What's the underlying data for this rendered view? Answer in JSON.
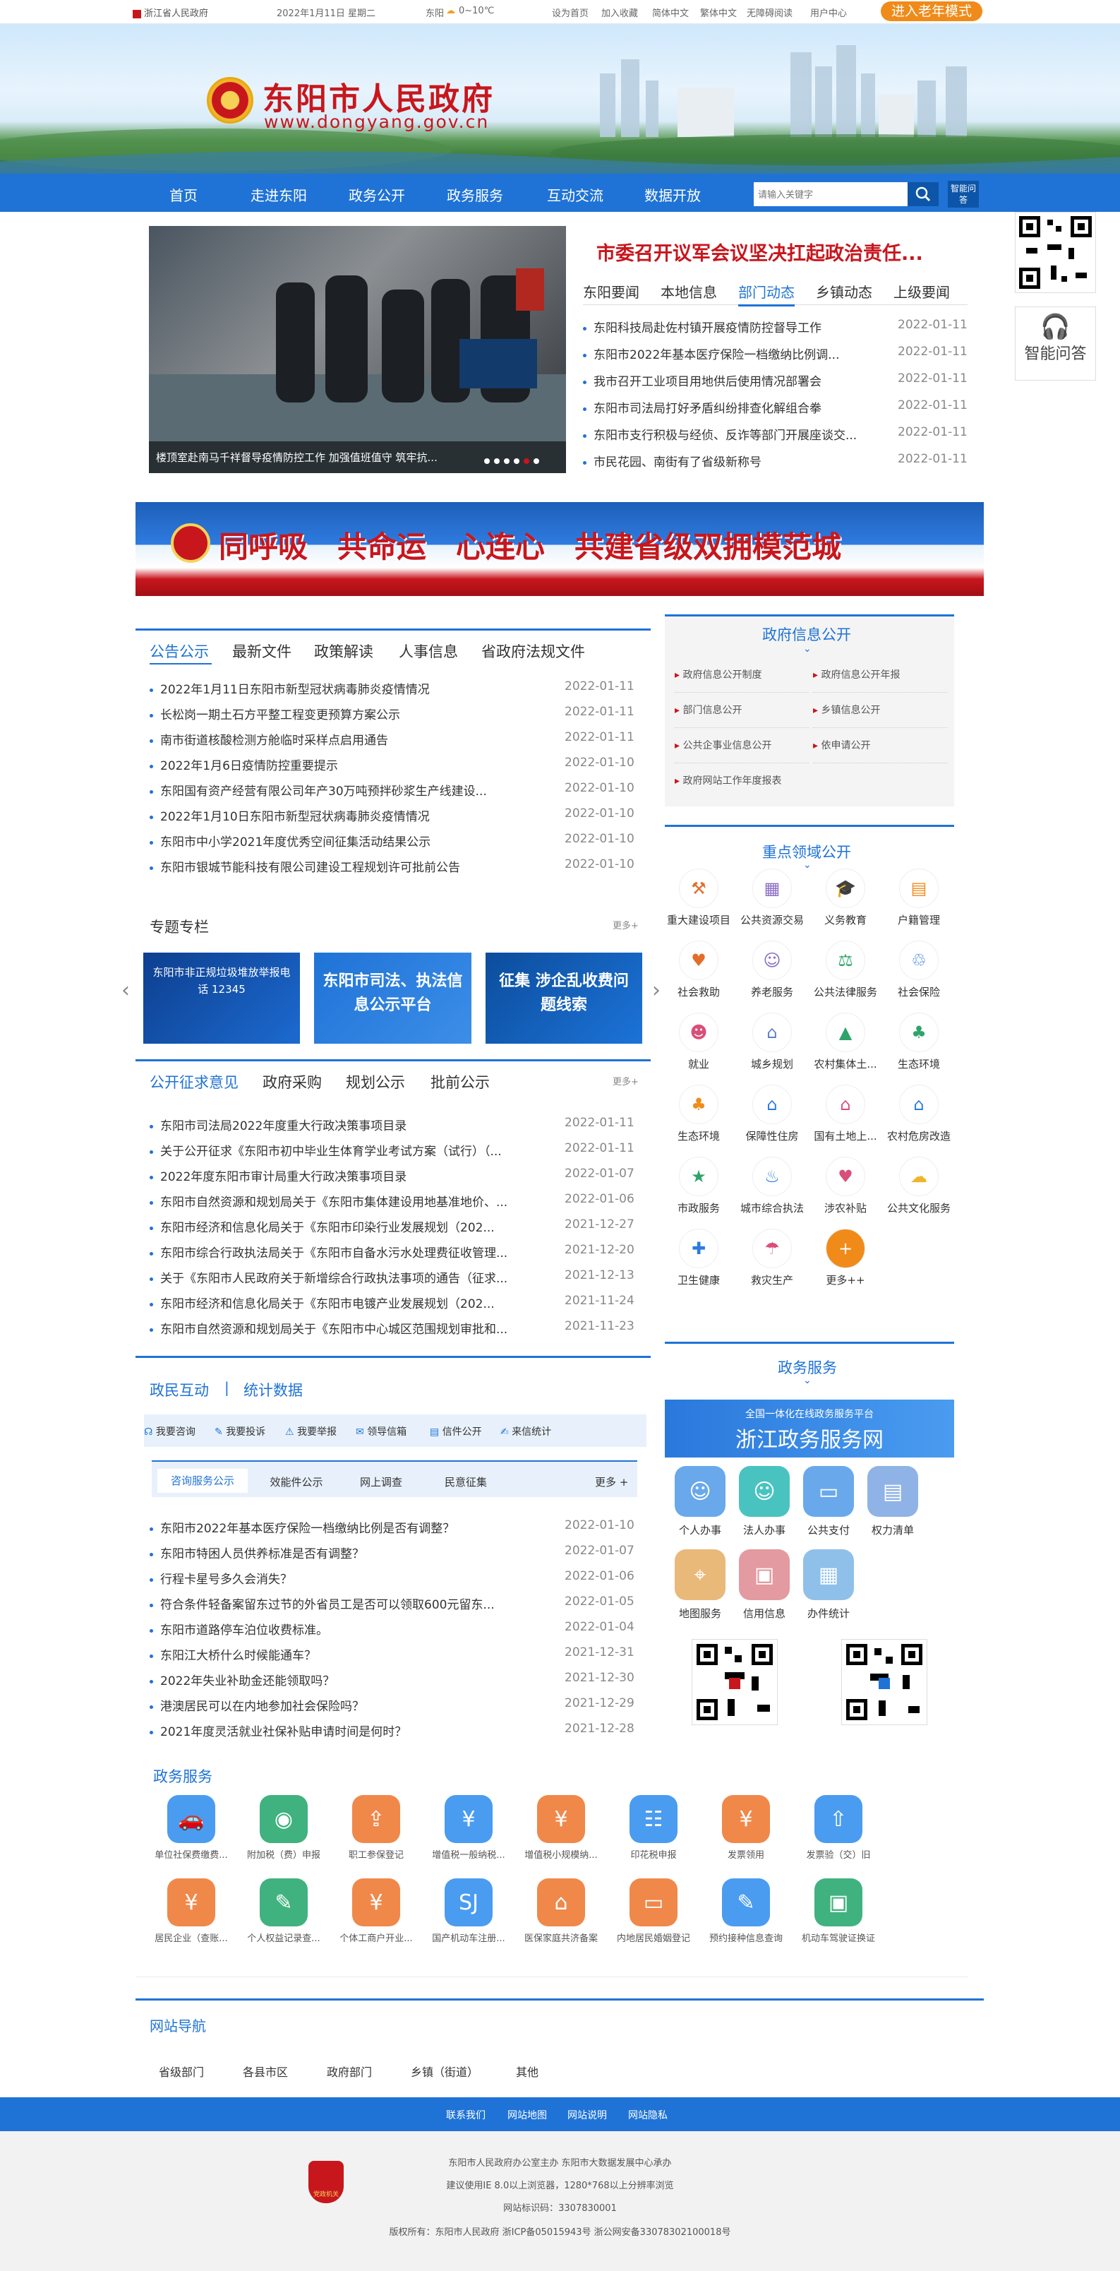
{
  "topbar": {
    "site": "浙江省人民政府",
    "date": "2022年1月11日 星期二",
    "weather_city": "东阳",
    "weather_temp": "0~10℃",
    "links": [
      "设为首页",
      "加入收藏",
      "简体中文",
      "繁体中文",
      "无障碍阅读"
    ],
    "user": "用户中心",
    "elder": "进入老年模式"
  },
  "banner": {
    "title": "东阳市人民政府",
    "url": "www.dongyang.gov.cn"
  },
  "nav": {
    "items": [
      "首页",
      "走进东阳",
      "政务公开",
      "政务服务",
      "互动交流",
      "数据开放"
    ],
    "search_placeholder": "请输入关键字",
    "qa_button": "智能问答"
  },
  "side": {
    "qa_label": "智能问答"
  },
  "headline": {
    "title": "市委召开议军会议坚决扛起政治责任...",
    "caption": "楼顶室赴南马千祥督导疫情防控工作 加强值班值守 筑牢抗..."
  },
  "news_tabs": [
    "东阳要闻",
    "本地信息",
    "部门动态",
    "乡镇动态",
    "上级要闻"
  ],
  "news_list": [
    {
      "t": "东阳科技局赴佐村镇开展疫情防控督导工作",
      "d": "2022-01-11"
    },
    {
      "t": "东阳市2022年基本医疗保险一档缴纳比例调...",
      "d": "2022-01-11"
    },
    {
      "t": "我市召开工业项目用地供后使用情况部署会",
      "d": "2022-01-11"
    },
    {
      "t": "东阳市司法局打好矛盾纠纷排查化解组合拳",
      "d": "2022-01-11"
    },
    {
      "t": "东阳市支行积极与经侦、反诈等部门开展座谈交...",
      "d": "2022-01-11"
    },
    {
      "t": "市民花园、南街有了省级新称号",
      "d": "2022-01-11"
    }
  ],
  "slogan": "同呼吸　共命运　心连心　共建省级双拥模范城",
  "notice_tabs": [
    "公告公示",
    "最新文件",
    "政策解读",
    "人事信息",
    "省政府法规文件"
  ],
  "notice_list": [
    {
      "t": "2022年1月11日东阳市新型冠状病毒肺炎疫情情况",
      "d": "2022-01-11"
    },
    {
      "t": "长松岗一期土石方平整工程变更预算方案公示",
      "d": "2022-01-11"
    },
    {
      "t": "南市街道核酸检测方舱临时采样点启用通告",
      "d": "2022-01-11"
    },
    {
      "t": "2022年1月6日疫情防控重要提示",
      "d": "2022-01-10"
    },
    {
      "t": "东阳国有资产经营有限公司年产30万吨预拌砂浆生产线建设...",
      "d": "2022-01-10"
    },
    {
      "t": "2022年1月10日东阳市新型冠状病毒肺炎疫情情况",
      "d": "2022-01-10"
    },
    {
      "t": "东阳市中小学2021年度优秀空间征集活动结果公示",
      "d": "2022-01-10"
    },
    {
      "t": "东阳市银城节能科技有限公司建设工程规划许可批前公告",
      "d": "2022-01-10"
    }
  ],
  "special": {
    "title": "专题专栏",
    "more": "更多+",
    "cards": [
      "东阳市非正规垃圾堆放举报电话 12345",
      "东阳市司法、执法信息公示平台",
      "征集 涉企乱收费问题线索"
    ]
  },
  "consult_tabs": [
    "公开征求意见",
    "政府采购",
    "规划公示",
    "批前公示"
  ],
  "consult_more": "更多+",
  "consult_list": [
    {
      "t": "东阳市司法局2022年度重大行政决策事项目录",
      "d": "2022-01-11"
    },
    {
      "t": "关于公开征求《东阳市初中毕业生体育学业考试方案（试行）（...",
      "d": "2022-01-11"
    },
    {
      "t": "2022年度东阳市审计局重大行政决策事项目录",
      "d": "2022-01-07"
    },
    {
      "t": "东阳市自然资源和规划局关于《东阳市集体建设用地基准地价、...",
      "d": "2022-01-06"
    },
    {
      "t": "东阳市经济和信息化局关于《东阳市印染行业发展规划（202...",
      "d": "2021-12-27"
    },
    {
      "t": "东阳市综合行政执法局关于《东阳市自备水污水处理费征收管理...",
      "d": "2021-12-20"
    },
    {
      "t": "关于《东阳市人民政府关于新增综合行政执法事项的通告（征求...",
      "d": "2021-12-13"
    },
    {
      "t": "东阳市经济和信息化局关于《东阳市电镀产业发展规划（202...",
      "d": "2021-11-24"
    },
    {
      "t": "东阳市自然资源和规划局关于《东阳市中心城区范围规划审批和...",
      "d": "2021-11-23"
    }
  ],
  "gov_info": {
    "title": "政府信息公开",
    "items": [
      "政府信息公开制度",
      "政府信息公开年报",
      "部门信息公开",
      "乡镇信息公开",
      "公共企事业信息公开",
      "依申请公开",
      "政府网站工作年度报表"
    ]
  },
  "key_area": {
    "title": "重点领域公开",
    "items": [
      "重大建设项目",
      "公共资源交易",
      "义务教育",
      "户籍管理",
      "社会救助",
      "养老服务",
      "公共法律服务",
      "社会保险",
      "就业",
      "城乡规划",
      "农村集体土...",
      "生态环境",
      "生态环境",
      "保障性住房",
      "国有土地上...",
      "农村危房改造",
      "市政服务",
      "城市综合执法",
      "涉农补贴",
      "公共文化服务",
      "卫生健康",
      "救灾生产",
      "更多++"
    ]
  },
  "interact": {
    "tab1": "政民互动",
    "tab2": "统计数据",
    "tools": [
      "我要咨询",
      "我要投诉",
      "我要举报",
      "领导信箱",
      "信件公开",
      "来信统计"
    ],
    "subtabs": [
      "咨询服务公示",
      "效能件公示",
      "网上调查",
      "民意征集"
    ],
    "more": "更多 +"
  },
  "interact_list": [
    {
      "t": "东阳市2022年基本医疗保险一档缴纳比例是否有调整？",
      "d": "2022-01-10"
    },
    {
      "t": "东阳市特困人员供养标准是否有调整？",
      "d": "2022-01-07"
    },
    {
      "t": "行程卡星号多久会消失？",
      "d": "2022-01-06"
    },
    {
      "t": "符合条件轻备案留东过节的外省员工是否可以领取600元留东...",
      "d": "2022-01-05"
    },
    {
      "t": "东阳市道路停车泊位收费标准。",
      "d": "2022-01-04"
    },
    {
      "t": "东阳江大桥什么时候能通车？",
      "d": "2021-12-31"
    },
    {
      "t": "2022年失业补助金还能领取吗？",
      "d": "2021-12-30"
    },
    {
      "t": "港澳居民可以在内地参加社会保险吗？",
      "d": "2021-12-29"
    },
    {
      "t": "2021年度灵活就业社保补贴申请时间是何时？",
      "d": "2021-12-28"
    }
  ],
  "gov_service": {
    "title": "政务服务",
    "sub": "全国一体化在线政务服务平台",
    "net": "浙江政务服务网",
    "items": [
      "个人办事",
      "法人办事",
      "公共支付",
      "权力清单",
      "地图服务",
      "信用信息",
      "办件统计"
    ]
  },
  "tax": {
    "title": "政务服务",
    "items": [
      "单位社保费缴费...",
      "附加税（费）申报",
      "职工参保登记",
      "增值税一般纳税...",
      "增值税小规模纳...",
      "印花税申报",
      "发票领用",
      "发票验（交）旧",
      "居民企业（查账...",
      "个人权益记录查...",
      "个体工商户开业...",
      "国产机动车注册...",
      "医保家庭共济备案",
      "内地居民婚姻登记",
      "预约接种信息查询",
      "机动车驾驶证换证"
    ]
  },
  "site_nav": {
    "title": "网站导航",
    "items": [
      "省级部门",
      "各县市区",
      "政府部门",
      "乡镇（街道）",
      "其他"
    ]
  },
  "footer": {
    "links": [
      "联系我们",
      "网站地图",
      "网站说明",
      "网站隐私"
    ],
    "lines": [
      "东阳市人民政府办公室主办 东阳市大数据发展中心承办",
      "建议使用IE 8.0以上浏览器，1280*768以上分辨率浏览",
      "网站标识码：3307830001",
      "版权所有：东阳市人民政府 浙ICP备05015943号    浙公网安备33078302100018号"
    ],
    "badge": "党政机关"
  },
  "colors": {
    "primary": "#1f73d6",
    "orange": "#f08b1a",
    "red": "#c8161d"
  }
}
